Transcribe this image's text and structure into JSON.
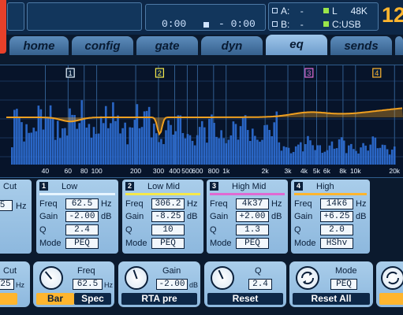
{
  "transport": {
    "time_left": "0:00",
    "time_right": "- 0:00"
  },
  "status": {
    "a_label": "A:",
    "dash1": "-",
    "b_label": "B:",
    "dash2": "-",
    "l_label": "L",
    "rate": "48K",
    "c_label": "C:USB",
    "big_number": "12"
  },
  "tabs": [
    {
      "label": "home"
    },
    {
      "label": "config"
    },
    {
      "label": "gate"
    },
    {
      "label": "dyn"
    },
    {
      "label": "eq"
    },
    {
      "label": "sends"
    }
  ],
  "active_tab": "eq",
  "graph": {
    "freq_labels": [
      "40",
      "60",
      "80",
      "100",
      "200",
      "300",
      "400",
      "500",
      "600",
      "800",
      "1k",
      "2k",
      "3k",
      "4k",
      "5k",
      "6k",
      "8k",
      "10k",
      "20k"
    ],
    "markers": [
      "1",
      "2",
      "3",
      "4"
    ],
    "curve_color": "#f0a020"
  },
  "params": {
    "freq": "Freq",
    "gain": "Gain",
    "q": "Q",
    "mode": "Mode",
    "hz": "Hz",
    "db": "dB"
  },
  "left_partial": {
    "title": "Cut",
    "val": "5",
    "unit": "Hz"
  },
  "bands": [
    {
      "num": "1",
      "name": "Low",
      "freq": "62.5",
      "gain": "-2.00",
      "q": "2.4",
      "mode": "PEQ",
      "color": "#e7f5ff"
    },
    {
      "num": "2",
      "name": "Low Mid",
      "freq": "306.2",
      "gain": "-8.25",
      "q": "10",
      "mode": "PEQ",
      "color": "#f5e84a"
    },
    {
      "num": "3",
      "name": "High Mid",
      "freq": "4k37",
      "gain": "+2.00",
      "q": "1.3",
      "mode": "PEQ",
      "color": "#e06ad2"
    },
    {
      "num": "4",
      "name": "High",
      "freq": "14k6",
      "gain": "+6.25",
      "q": "2.0",
      "mode": "HShv",
      "color": "#ffb52e"
    }
  ],
  "controls": {
    "cut": {
      "title": "Cut",
      "value": "25",
      "unit": "Hz"
    },
    "freq": {
      "title": "Freq",
      "value": "62.5",
      "unit": "Hz",
      "btn_bar": "Bar",
      "btn_spec": "Spec"
    },
    "gain": {
      "title": "Gain",
      "value": "-2.00",
      "unit": "dB",
      "btn": "RTA pre"
    },
    "q": {
      "title": "Q",
      "value": "2.4",
      "btn": "Reset"
    },
    "mode": {
      "title": "Mode",
      "value": "PEQ",
      "btn": "Reset All"
    }
  }
}
